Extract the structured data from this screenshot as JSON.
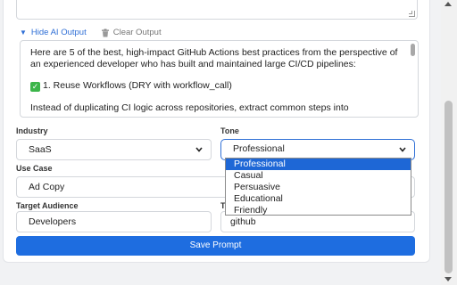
{
  "output_toggle": {
    "hide_label": "Hide AI Output",
    "clear_label": "Clear Output"
  },
  "ai_output": {
    "intro": "Here are 5 of the best, high-impact GitHub Actions best practices from the perspective of an experienced developer who has built and maintained large CI/CD pipelines:",
    "item1": "1. Reuse Workflows (DRY with workflow_call)",
    "item1_body": "Instead of duplicating CI logic across repositories, extract common steps into"
  },
  "fields": {
    "industry": {
      "label": "Industry",
      "value": "SaaS"
    },
    "tone": {
      "label": "Tone",
      "value": "Professional",
      "options": [
        "Professional",
        "Casual",
        "Persuasive",
        "Educational",
        "Friendly"
      ]
    },
    "use_case": {
      "label": "Use Case",
      "value": "Ad Copy"
    },
    "target_audience": {
      "label": "Target Audience",
      "value": "Developers"
    },
    "tags": {
      "label": "T",
      "value": "github"
    }
  },
  "save_button": "Save Prompt",
  "colors": {
    "accent": "#1e6de0",
    "selected_option": "#1e67d6",
    "check": "#3cb54a"
  }
}
